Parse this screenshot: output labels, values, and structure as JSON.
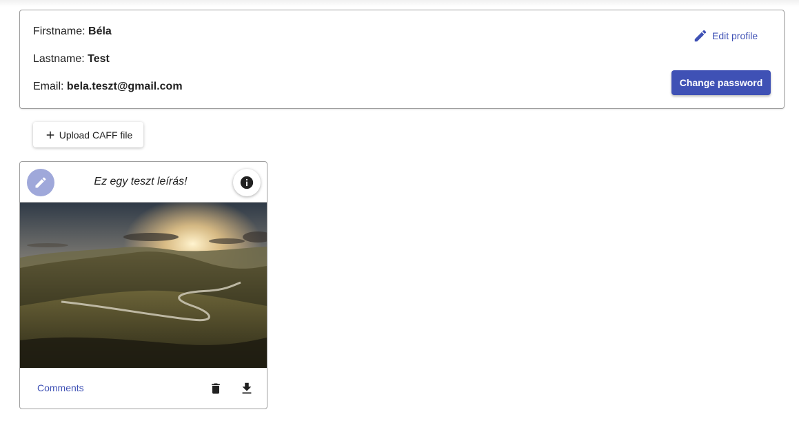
{
  "profile": {
    "firstname_label": "Firstname:",
    "firstname_value": "Béla",
    "lastname_label": "Lastname:",
    "lastname_value": "Test",
    "email_label": "Email:",
    "email_value": "bela.teszt@gmail.com",
    "edit_label": "Edit profile",
    "change_password_label": "Change password"
  },
  "upload": {
    "label": "Upload CAFF file"
  },
  "caff_card": {
    "description": "Ez egy teszt leírás!",
    "comments_label": "Comments"
  },
  "icons": {
    "edit": "pencil-icon",
    "info": "info-icon",
    "add": "plus-icon",
    "delete": "trash-icon",
    "download": "download-icon"
  },
  "colors": {
    "primary": "#3f51b5",
    "primary_light": "#9fa8da",
    "border": "#9e9e9e"
  }
}
